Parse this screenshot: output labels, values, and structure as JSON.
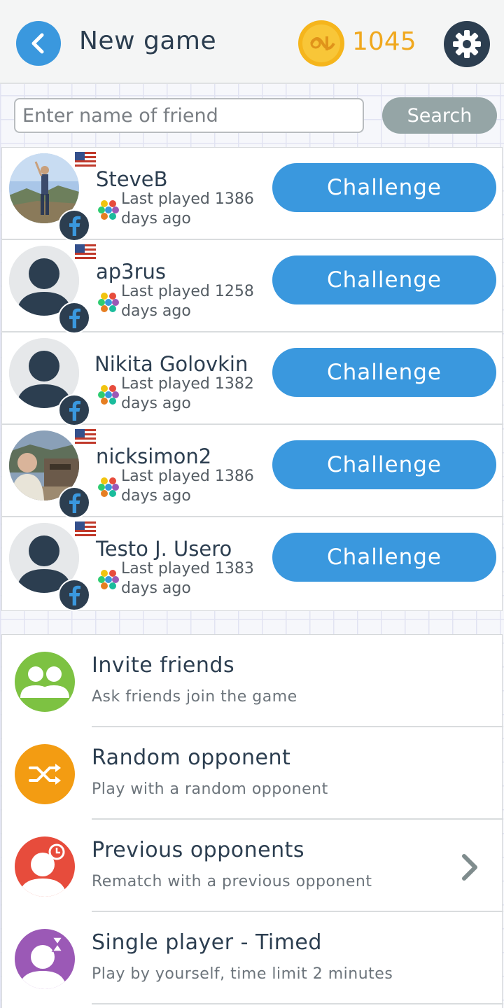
{
  "header": {
    "title": "New game",
    "coins": "1045"
  },
  "search": {
    "placeholder": "Enter name of friend",
    "button_label": "Search"
  },
  "friends": [
    {
      "name": "SteveB",
      "last_played": "Last played 1386 days ago",
      "avatar": "photo-mountain",
      "flag": true,
      "button": "Challenge"
    },
    {
      "name": "ap3rus",
      "last_played": "Last played 1258 days ago",
      "avatar": "default",
      "flag": true,
      "button": "Challenge"
    },
    {
      "name": "Nikita Golovkin",
      "last_played": "Last played 1382 days ago",
      "avatar": "default",
      "flag": false,
      "button": "Challenge"
    },
    {
      "name": "nicksimon2",
      "last_played": "Last played 1386 days ago",
      "avatar": "photo-man",
      "flag": true,
      "button": "Challenge"
    },
    {
      "name": "Testo J. Usero",
      "last_played": "Last played 1383 days ago",
      "avatar": "default",
      "flag": true,
      "button": "Challenge"
    }
  ],
  "options": [
    {
      "title": "Invite friends",
      "subtitle": "Ask friends join the game",
      "icon": "group-icon",
      "color": "#7dc242"
    },
    {
      "title": "Random opponent",
      "subtitle": "Play with a random opponent",
      "icon": "shuffle-icon",
      "color": "#f39c12"
    },
    {
      "title": "Previous opponents",
      "subtitle": "Rematch with a previous opponent",
      "icon": "rematch-icon",
      "color": "#e74c3c",
      "chevron": true
    },
    {
      "title": "Single player - Timed",
      "subtitle": "Play by yourself, time limit 2 minutes",
      "icon": "timer-icon",
      "color": "#9b59b6"
    }
  ],
  "colors": {
    "accent": "#3a98de",
    "coin": "#f0a81e",
    "dark": "#2c3e50",
    "search_button": "#95a5a6"
  }
}
